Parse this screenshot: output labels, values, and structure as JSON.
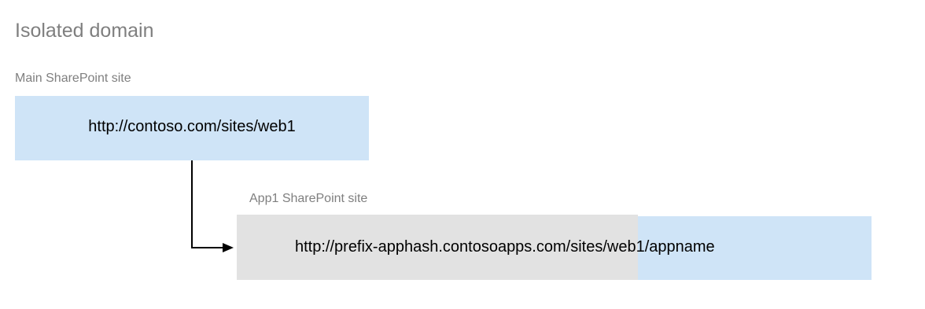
{
  "title": "Isolated domain",
  "main_site": {
    "caption": "Main SharePoint site",
    "url": "http://contoso.com/sites/web1"
  },
  "app_site": {
    "caption": "App1 SharePoint site",
    "url_domain": "http://prefix-apphash.contosoapps.com",
    "url_path": "/sites/web1/appname"
  },
  "colors": {
    "blue_box": "#cfe4f7",
    "gray_box": "#e2e2e2",
    "caption_text": "#7f7f7f"
  }
}
